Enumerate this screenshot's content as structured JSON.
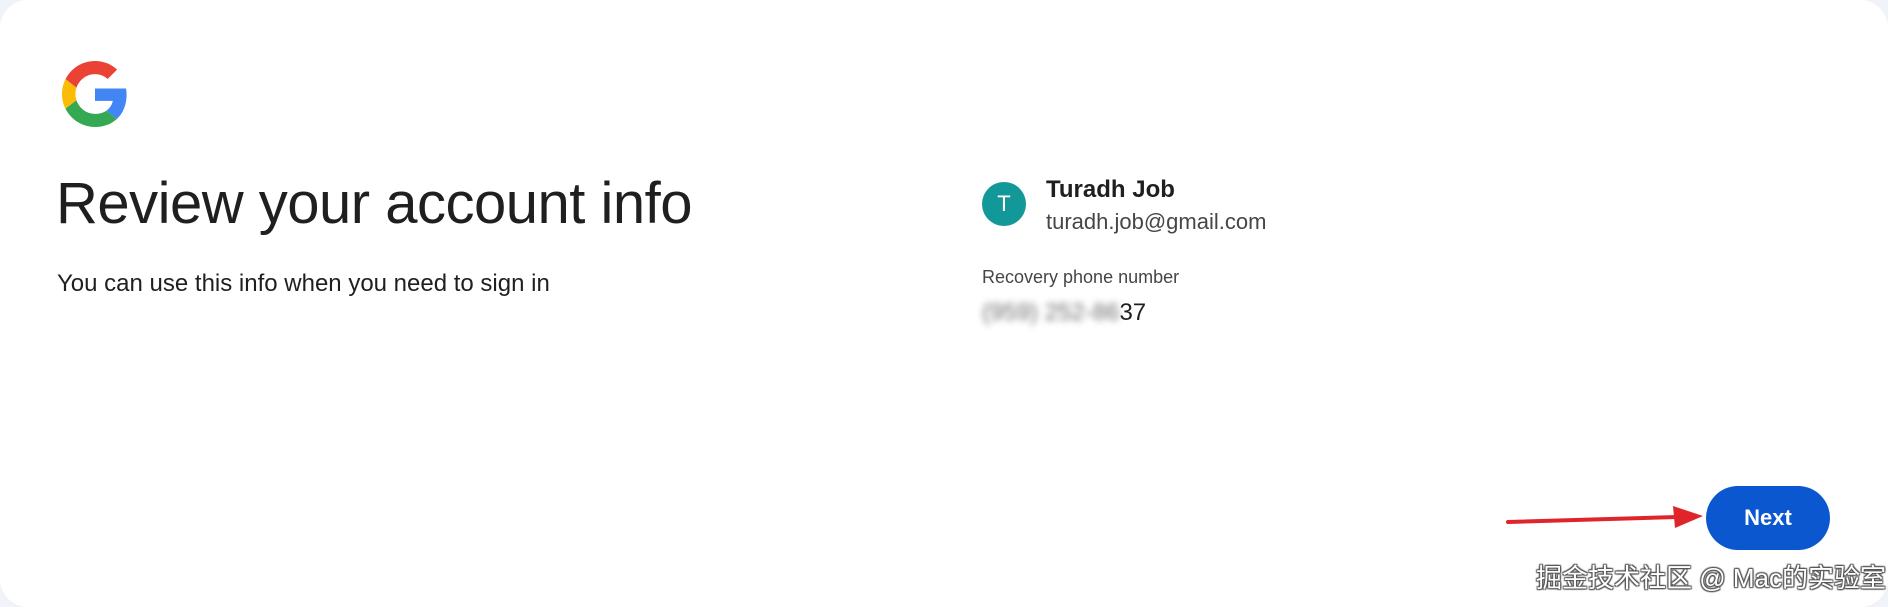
{
  "brand": {
    "logo_icon": "google-g-logo-icon",
    "colors": {
      "blue": "#4285F4",
      "red": "#EA4335",
      "yellow": "#FBBC05",
      "green": "#34A853"
    }
  },
  "main": {
    "title": "Review your account info",
    "subtitle": "You can use this info when you need to sign in"
  },
  "account": {
    "avatar_initial": "T",
    "avatar_color": "#13989a",
    "name": "Turadh Job",
    "email": "turadh.job@gmail.com"
  },
  "recovery": {
    "label": "Recovery phone number",
    "value_hidden": "(959) 252-86",
    "value_visible": "37"
  },
  "actions": {
    "next_label": "Next",
    "next_color": "#0b57d0"
  },
  "annotation": {
    "arrow_color": "#e0252a"
  },
  "watermark": "掘金技术社区 @ Mac的实验室"
}
